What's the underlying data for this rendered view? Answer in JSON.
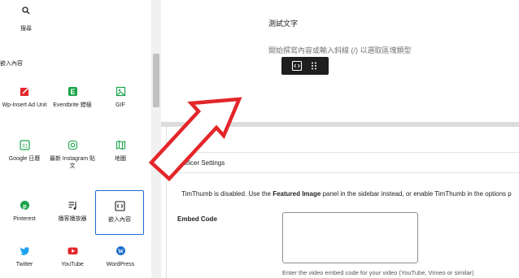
{
  "inserter": {
    "search_label": "搜尋",
    "section_title": "嵌入內容",
    "blocks": [
      {
        "label": "Wp-Insert Ad Unit",
        "icon": "wp-insert-icon"
      },
      {
        "label": "Eventbrite 錯極",
        "icon": "eventbrite-icon"
      },
      {
        "label": "GIF",
        "icon": "gif-icon"
      },
      {
        "label": "Google 日曆",
        "icon": "google-calendar-icon"
      },
      {
        "label": "最新 Instagram 貼文",
        "icon": "instagram-icon"
      },
      {
        "label": "地圖",
        "icon": "map-icon"
      },
      {
        "label": "Pinterest",
        "icon": "pinterest-icon"
      },
      {
        "label": "播客播放器",
        "icon": "podcast-player-icon"
      },
      {
        "label": "嵌入內容",
        "icon": "embed-icon"
      },
      {
        "label": "Twitter",
        "icon": "twitter-icon"
      },
      {
        "label": "YouTube",
        "icon": "youtube-icon"
      },
      {
        "label": "WordPress",
        "icon": "wordpress-icon"
      }
    ]
  },
  "editor": {
    "paragraph_text": "測試文字",
    "placeholder_text": "開始撰寫內容或輸入斜線 (/) 以選取區塊類型"
  },
  "metabox": {
    "hidden_title": "Artificer",
    "title": "Artificer Settings",
    "notice_prefix": "TimThumb is disabled. Use the ",
    "notice_bold": "Featured Image",
    "notice_suffix": " panel in the sidebar instead, or enable TimThumb in the options p",
    "embed_label": "Embed Code",
    "embed_help": "Enter the video embed code for your video (YouTube, Vimeo or similar)",
    "embed_value": ""
  },
  "colors": {
    "accent": "#1e6ccf",
    "arrow_red": "#e3262a",
    "toolbar_bg": "#1e1e1e"
  }
}
